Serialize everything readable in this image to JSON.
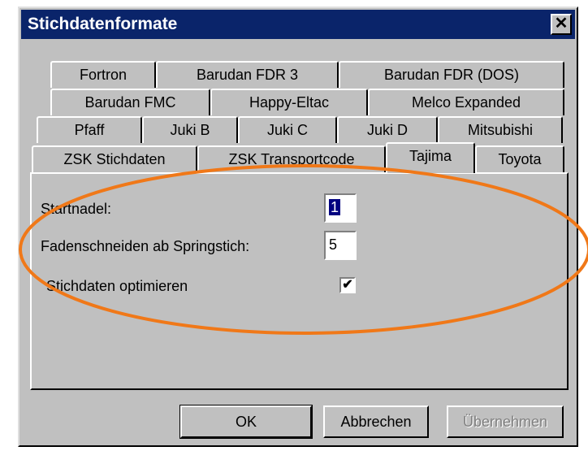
{
  "window": {
    "title": "Stichdatenformate",
    "close_glyph": "✕"
  },
  "tabs": {
    "row1": [
      "Fortron",
      "Barudan FDR 3",
      "Barudan FDR (DOS)"
    ],
    "row2": [
      "Barudan FMC",
      "Happy-Eltac",
      "Melco Expanded"
    ],
    "row3": [
      "Pfaff",
      "Juki B",
      "Juki C",
      "Juki D",
      "Mitsubishi"
    ],
    "row4": [
      "ZSK Stichdaten",
      "ZSK Transportcode",
      "Tajima",
      "Toyota"
    ],
    "active": "Tajima"
  },
  "form": {
    "startnadel_label": "Startnadel:",
    "startnadel_value": "1",
    "faden_label": "Fadenschneiden ab Springstich:",
    "faden_value": "5",
    "optimieren_label": "Stichdaten optimieren",
    "optimieren_checked": true,
    "check_glyph": "✔"
  },
  "buttons": {
    "ok": "OK",
    "cancel": "Abbrechen",
    "apply": "Übernehmen"
  },
  "colors": {
    "titlebar": "#0a246a",
    "face": "#c0c0c0",
    "annotation": "#f07818"
  }
}
